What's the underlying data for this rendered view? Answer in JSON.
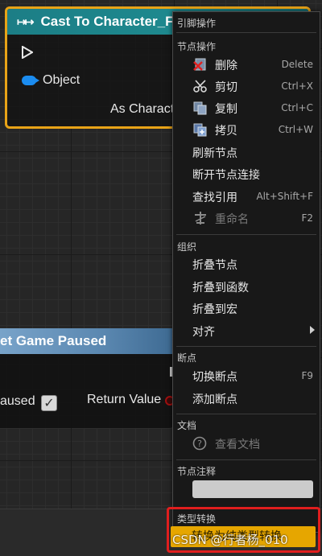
{
  "cast_node": {
    "title": "Cast To Character_Fi",
    "object_label": "Object",
    "output_label": "As Characte",
    "header_color": "#1e8a8f",
    "border_color": "#e8a317"
  },
  "pause_node": {
    "title": "et Game Paused",
    "paused_label": "aused",
    "return_label": "Return Value",
    "header_color": "#5a87b0"
  },
  "menu": {
    "header": "引脚操作",
    "sections": {
      "node_ops": "节点操作",
      "organize": "组织",
      "breakpoints": "断点",
      "docs": "文档",
      "node_comment": "节点注释",
      "type_cast": "类型转换"
    },
    "items": {
      "delete": {
        "label": "删除",
        "shortcut": "Delete"
      },
      "cut": {
        "label": "剪切",
        "shortcut": "Ctrl+X"
      },
      "copy": {
        "label": "复制",
        "shortcut": "Ctrl+C"
      },
      "duplicate": {
        "label": "拷贝",
        "shortcut": "Ctrl+W"
      },
      "refresh": {
        "label": "刷新节点"
      },
      "break_links": {
        "label": "断开节点连接"
      },
      "find_refs": {
        "label": "查找引用",
        "shortcut": "Alt+Shift+F"
      },
      "rename": {
        "label": "重命名",
        "shortcut": "F2"
      },
      "collapse_nodes": {
        "label": "折叠节点"
      },
      "collapse_function": {
        "label": "折叠到函数"
      },
      "collapse_macro": {
        "label": "折叠到宏"
      },
      "align": {
        "label": "对齐"
      },
      "toggle_breakpoint": {
        "label": "切换断点",
        "shortcut": "F9"
      },
      "add_breakpoint": {
        "label": "添加断点"
      },
      "view_docs": {
        "label": "查看文档"
      },
      "pure_cast": {
        "label": "转换为纯类型转换"
      }
    }
  },
  "watermark": "CSDN @行者杨_010",
  "colors": {
    "highlight_frame": "#e01e1e",
    "selected_item": "#e6a600"
  }
}
